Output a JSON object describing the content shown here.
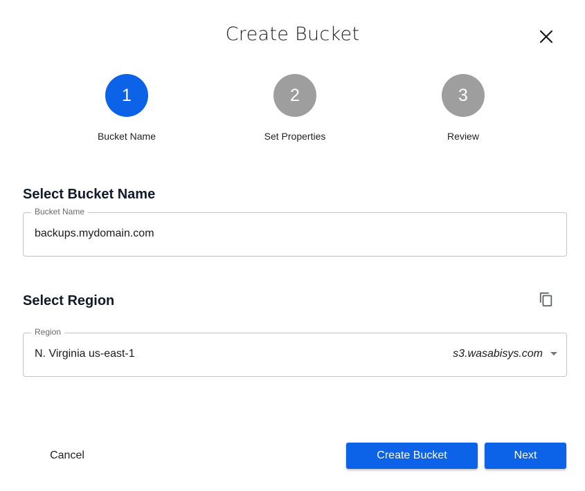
{
  "dialog": {
    "title": "Create Bucket"
  },
  "stepper": {
    "steps": [
      {
        "number": "1",
        "label": "Bucket Name",
        "state": "active"
      },
      {
        "number": "2",
        "label": "Set Properties",
        "state": "inactive"
      },
      {
        "number": "3",
        "label": "Review",
        "state": "inactive"
      }
    ]
  },
  "bucket_section": {
    "title": "Select Bucket Name",
    "field_label": "Bucket Name",
    "field_value": "backups.mydomain.com"
  },
  "region_section": {
    "title": "Select Region",
    "field_label": "Region",
    "selected_region": "N. Virginia us-east-1",
    "endpoint": "s3.wasabisys.com"
  },
  "footer": {
    "cancel_label": "Cancel",
    "create_label": "Create Bucket",
    "next_label": "Next"
  },
  "colors": {
    "primary": "#0c63e7",
    "step_inactive": "#9e9e9e"
  },
  "icons": {
    "close": "close-icon",
    "copy": "copy-icon",
    "dropdown": "chevron-down-icon"
  }
}
